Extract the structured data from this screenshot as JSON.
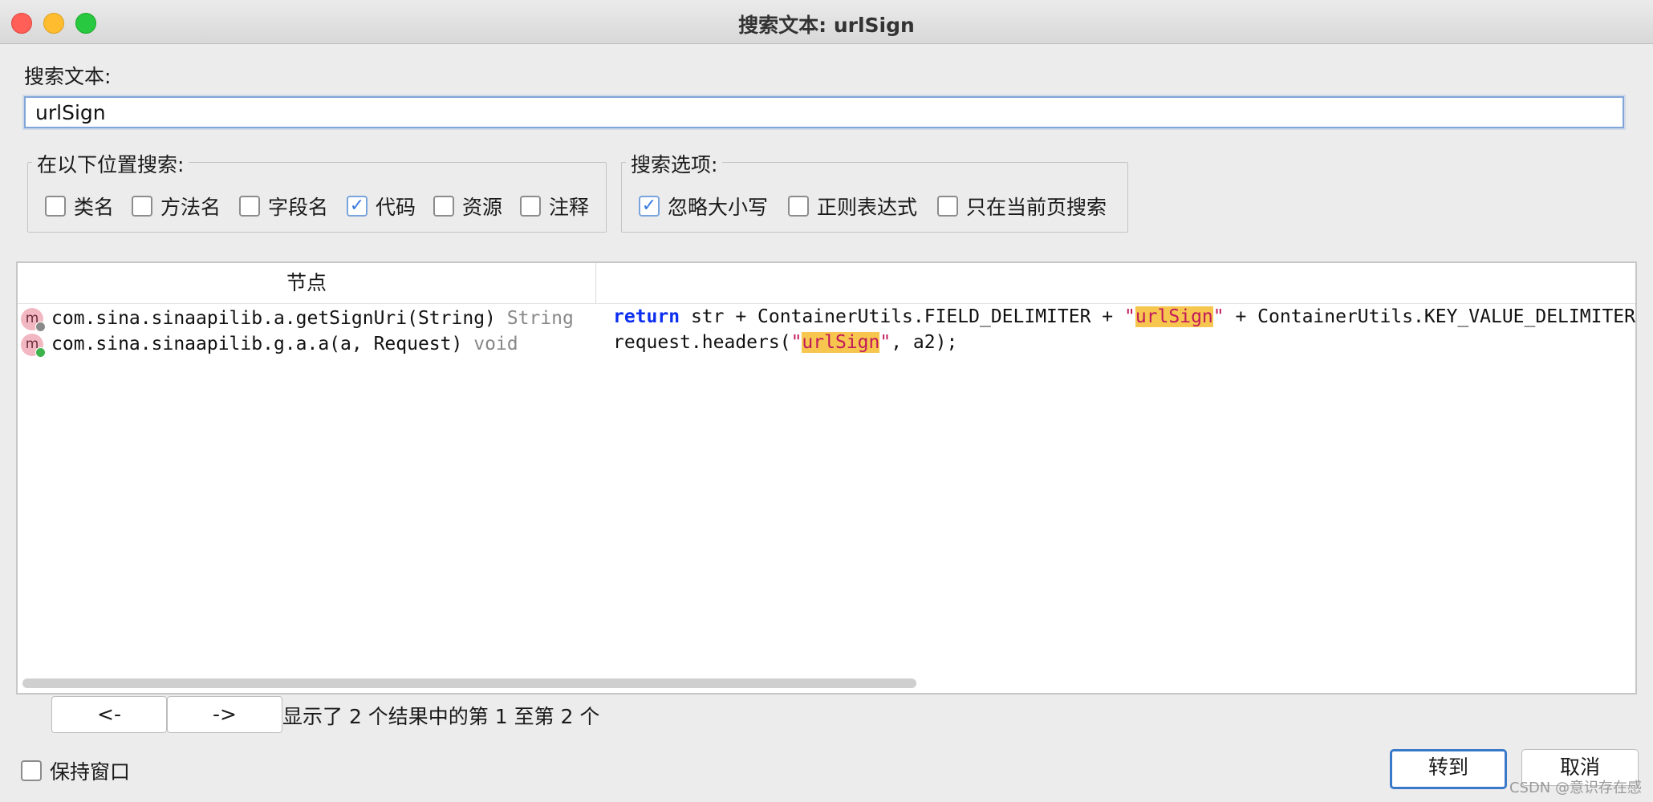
{
  "window": {
    "title": "搜索文本: urlSign"
  },
  "search": {
    "label": "搜索文本:",
    "value": "urlSign"
  },
  "location": {
    "legend": "在以下位置搜索:",
    "options": [
      {
        "label": "类名",
        "checked": false
      },
      {
        "label": "方法名",
        "checked": false
      },
      {
        "label": "字段名",
        "checked": false
      },
      {
        "label": "代码",
        "checked": true
      },
      {
        "label": "资源",
        "checked": false
      },
      {
        "label": "注释",
        "checked": false
      }
    ]
  },
  "search_options": {
    "legend": "搜索选项:",
    "options": [
      {
        "label": "忽略大小写",
        "checked": true
      },
      {
        "label": "正则表达式",
        "checked": false
      },
      {
        "label": "只在当前页搜索",
        "checked": false
      }
    ]
  },
  "results": {
    "column_node": "节点",
    "column_code": "",
    "rows": [
      {
        "icon": "method-icon",
        "icon_letter": "m",
        "badge_color": "#8a8a8a",
        "node": "com.sina.sinaapilib.a.getSignUri(String)",
        "return_type": "String",
        "code": {
          "kw": "return",
          "pre": " str + ContainerUtils.FIELD_DELIMITER + ",
          "q1": "\"",
          "match": "urlSign",
          "q2": "\"",
          "post": " + ContainerUtils.KEY_VALUE_DELIMITER"
        }
      },
      {
        "icon": "method-icon",
        "icon_letter": "m",
        "badge_color": "#3cb44b",
        "node": "com.sina.sinaapilib.g.a.a(a, Request)",
        "return_type": "void",
        "code": {
          "kw": "",
          "pre": "request.headers(",
          "q1": "\"",
          "match": "urlSign",
          "q2": "\"",
          "post": ", a2);"
        }
      }
    ]
  },
  "pager": {
    "prev_label": "<-",
    "next_label": "->",
    "status": "显示了 2 个结果中的第 1 至第 2 个"
  },
  "footer": {
    "keep_window_label": "保持窗口",
    "keep_window_checked": false,
    "goto_label": "转到",
    "cancel_label": "取消"
  },
  "watermark": "CSDN @意识存在感"
}
